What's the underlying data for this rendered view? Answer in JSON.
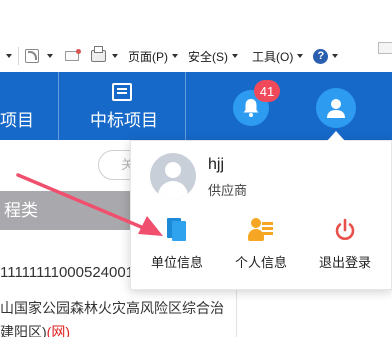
{
  "ie_toolbar": {
    "page_menu": "页面(P)",
    "safety_menu": "安全(S)",
    "tools_menu": "工具(O)",
    "help_icon": "?"
  },
  "nav": {
    "left_label_partial": "项目",
    "bid_projects": "中标项目",
    "notification_count": "41"
  },
  "background": {
    "search_placeholder_partial": "关",
    "type_header_partial": "程类",
    "row_number": "11111111000524001",
    "row_text_line1": "山国家公园森林火灾高风险区综合治",
    "row_text_line2": "建阳区)",
    "row_tag": "(网)"
  },
  "user_menu": {
    "username": "hjj",
    "role": "供应商",
    "actions": [
      {
        "label": "单位信息",
        "icon": "document-icon"
      },
      {
        "label": "个人信息",
        "icon": "profile-card-icon"
      },
      {
        "label": "退出登录",
        "icon": "power-icon"
      }
    ]
  },
  "colors": {
    "nav_blue": "#1669c9",
    "icon_circle_blue": "#2d9bf0",
    "badge_red": "#f04a5a",
    "annotation_arrow": "#f0506e",
    "power_red": "#e8504a",
    "profile_orange": "#f5a623"
  }
}
